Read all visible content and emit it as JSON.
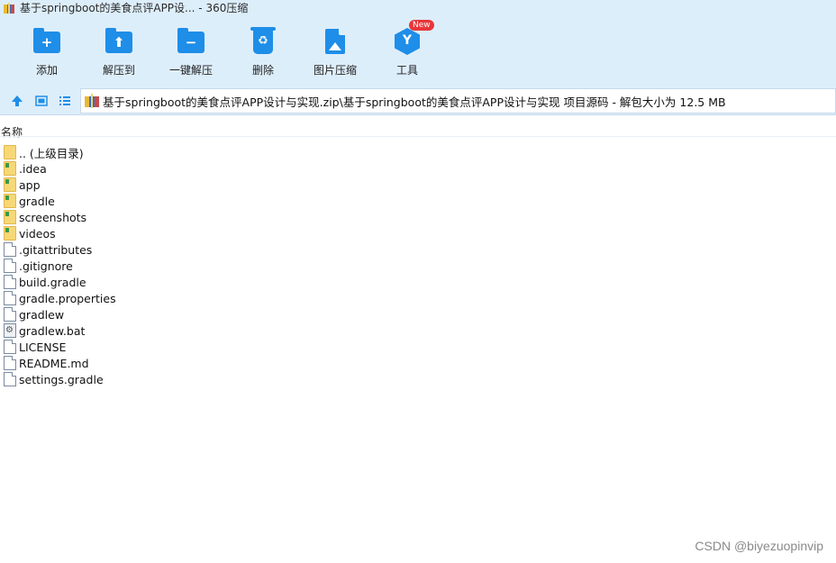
{
  "window": {
    "title": "基于springboot的美食点评APP设... - 360压缩"
  },
  "toolbar": {
    "items": [
      {
        "label": "添加",
        "icon": "add-folder-icon"
      },
      {
        "label": "解压到",
        "icon": "extract-to-icon"
      },
      {
        "label": "一键解压",
        "icon": "one-click-extract-icon"
      },
      {
        "label": "删除",
        "icon": "recycle-bin-icon"
      },
      {
        "label": "图片压缩",
        "icon": "image-compress-icon"
      },
      {
        "label": "工具",
        "icon": "tools-cube-icon",
        "badge": "New"
      }
    ],
    "accent": "#1e8ee8",
    "badge_color": "#e8363a"
  },
  "nav": {
    "up": "up-arrow-icon",
    "thumb": "thumbnail-view-icon",
    "list": "list-view-icon"
  },
  "address": {
    "path": "基于springboot的美食点评APP设计与实现.zip\\基于springboot的美食点评APP设计与实现 项目源码 - 解包大小为 12.5 MB"
  },
  "columns": {
    "name": "名称"
  },
  "files": [
    {
      "name": ".. (上级目录)",
      "type": "folder"
    },
    {
      "name": ".idea",
      "type": "folder-git"
    },
    {
      "name": "app",
      "type": "folder-git"
    },
    {
      "name": "gradle",
      "type": "folder-git"
    },
    {
      "name": "screenshots",
      "type": "folder-git"
    },
    {
      "name": "videos",
      "type": "folder-git"
    },
    {
      "name": ".gitattributes",
      "type": "file"
    },
    {
      "name": ".gitignore",
      "type": "file"
    },
    {
      "name": "build.gradle",
      "type": "file"
    },
    {
      "name": "gradle.properties",
      "type": "file"
    },
    {
      "name": "gradlew",
      "type": "file"
    },
    {
      "name": "gradlew.bat",
      "type": "bat"
    },
    {
      "name": "LICENSE",
      "type": "file"
    },
    {
      "name": "README.md",
      "type": "file"
    },
    {
      "name": "settings.gradle",
      "type": "file"
    }
  ],
  "watermark": "CSDN @biyezuopinvip"
}
